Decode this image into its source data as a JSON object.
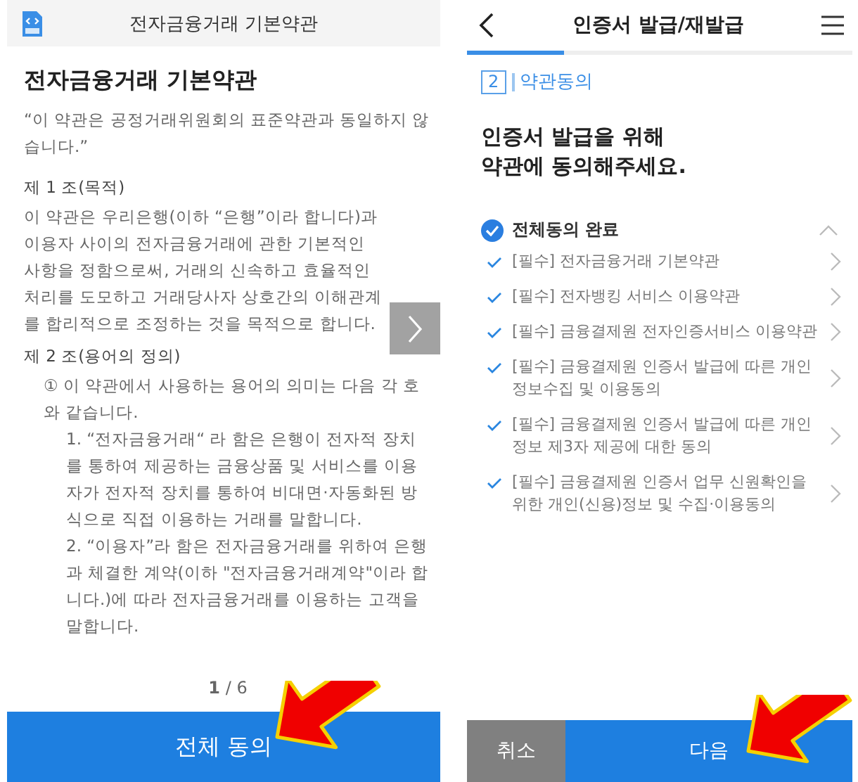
{
  "left_screen": {
    "header_title": "전자금융거래 기본약관",
    "heading": "전자금융거래 기본약관",
    "blocks": [
      {
        "kind": "notice",
        "text": "“이 약관은 공정거래위원회의 표준약관과 동일하지 않습니다.”"
      },
      {
        "kind": "article-title",
        "text": "제 1 조(목적)"
      },
      {
        "kind": "paragraph",
        "text": "이 약관은 우리은행(이하 “은행”이라 합니다)과 이용자 사이의 전자금융거래에 관한 기본적인 사항을 정함으로써, 거래의 신속하고 효율적인 처리를 도모하고 거래당사자 상호간의 이해관계를 합리적으로 조정하는 것을 목적으로 합니다."
      },
      {
        "kind": "article-title",
        "text": "제 2 조(용어의 정의)"
      },
      {
        "kind": "clause",
        "text": "① 이 약관에서 사용하는 용어의 의미는 다음 각 호와 같습니다."
      },
      {
        "kind": "item",
        "text": "1. “전자금융거래“ 라 함은 은행이 전자적 장치를 통하여 제공하는 금융상품 및 서비스를 이용자가 전자적 장치를 통하여 비대면·자동화된 방식으로 직접 이용하는 거래를 말합니다."
      },
      {
        "kind": "item",
        "text": "2. “이용자”라 함은 전자금융거래를 위하여 은행과 체결한 계약(이하 \"전자금융거래계약\"이라 합니다.)에 따라 전자금융거래를 이용하는 고객을 말합니다."
      }
    ],
    "page_indicator": "**1** / 6",
    "agree_button": "전체 동의"
  },
  "right_screen": {
    "title": "인증서 발급/재발급",
    "progress": {
      "level": 0.25
    },
    "step_number": "2",
    "step_label": "약관동의",
    "heading_lines": [
      "인증서 발급을 위해",
      "약관에 동의해주세요."
    ],
    "all_agree": {
      "label": "전체동의 완료",
      "checked": true,
      "expanded": true
    },
    "terms": [
      {
        "label": "[필수] 전자금융거래 기본약관",
        "checked": true
      },
      {
        "label": "[필수] 전자뱅킹 서비스 이용약관",
        "checked": true
      },
      {
        "label": "[필수] 금융결제원 전자인증서비스 이용약관",
        "checked": true
      },
      {
        "label": "[필수] 금융결제원 인증서 발급에 따른 개인정보수집 및 이용동의",
        "checked": true
      },
      {
        "label": "[필수] 금융결제원 인증서 발급에 따른 개인정보 제3자 제공에 대한 동의",
        "checked": true
      },
      {
        "label": "[필수] 금융결제원 인증서 업무 신원확인을 위한 개인(신용)정보 및 수집·이용동의",
        "checked": true
      }
    ],
    "cancel_button": "취소",
    "next_button": "다음"
  }
}
